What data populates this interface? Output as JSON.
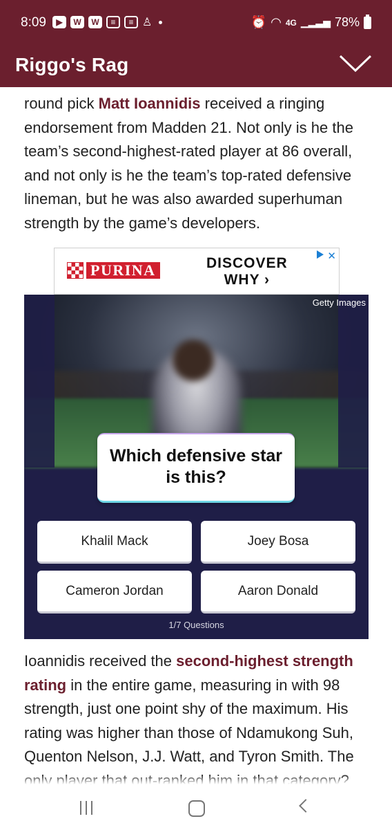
{
  "status_bar": {
    "time": "8:09",
    "network": "4G",
    "battery": "78%",
    "icons": [
      "youtube-icon",
      "w-app-icon",
      "w-app-icon",
      "news-icon",
      "news-icon",
      "notification-icon",
      "alarm-icon",
      "wifi-icon",
      "signal-icon",
      "battery-icon"
    ]
  },
  "header": {
    "title": "Riggo's Rag",
    "menu_icon": "chevron-down-icon"
  },
  "article": {
    "p1_before": "round pick ",
    "p1_link": "Matt Ioannidis",
    "p1_after": " received a ringing endorsement from Madden 21. Not only is he the team’s second-highest-rated player at 86 overall, and not only is he the team’s top-rated defensive lineman, but he was also awarded superhuman strength by the game’s developers.",
    "p2_before": "Ioannidis received the ",
    "p2_link": "second-highest strength rating",
    "p2_after": " in the entire game, measuring in with 98 strength, just one point shy of the maximum. His rating was higher than those of Ndamukong Suh, Quenton Nelson, J.J. Watt, and Tyron Smith. The only player that out-ranked him in that category?"
  },
  "ad": {
    "brand": "PURINA",
    "line1": "DISCOVER",
    "line2": "WHY ›",
    "close": "✕"
  },
  "quiz": {
    "credit": "Getty Images",
    "question": "Which defensive star is this?",
    "answers": [
      "Khalil Mack",
      "Joey Bosa",
      "Cameron Jordan",
      "Aaron Donald"
    ],
    "progress": "1/7 Questions"
  },
  "nav": {
    "recent_icon": "recent-apps-icon",
    "home_icon": "home-icon",
    "back_icon": "back-icon"
  },
  "colors": {
    "brand": "#6b1f2e",
    "quiz_bg": "#1f1e47",
    "ad_accent": "#1a7fd4"
  }
}
